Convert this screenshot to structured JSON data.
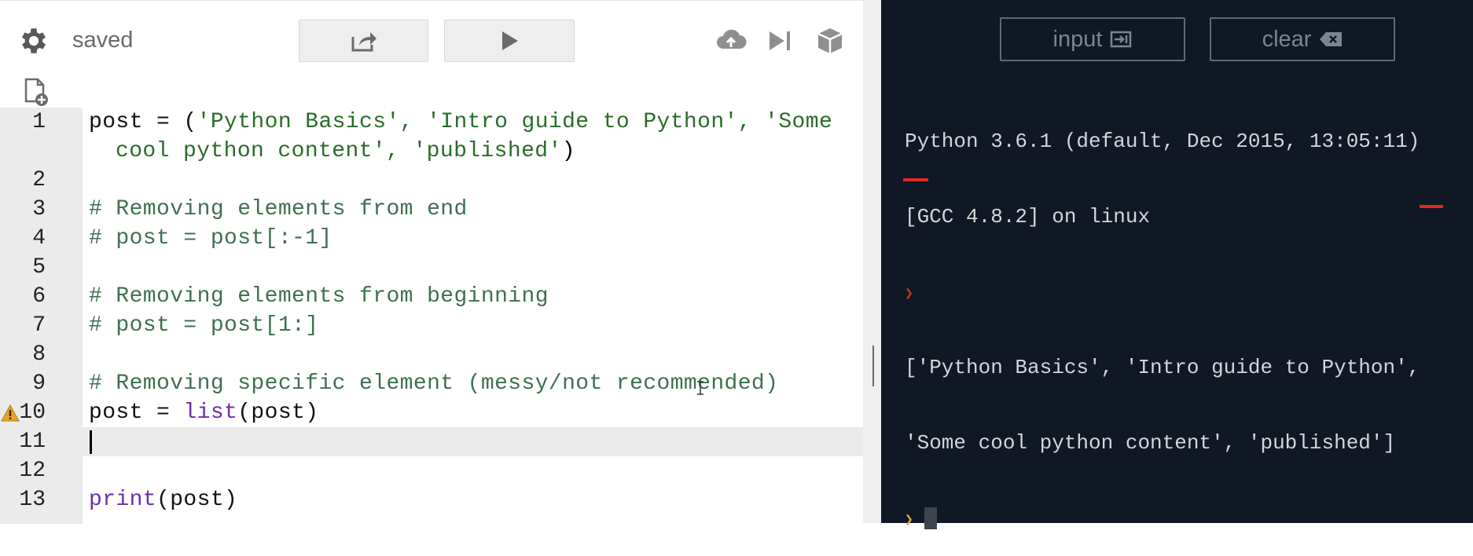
{
  "editor": {
    "status": "saved",
    "toolbar": {
      "icons": [
        "gear-icon",
        "share-icon",
        "play-icon",
        "cloud-upload-icon",
        "step-end-icon",
        "package-icon",
        "new-file-icon"
      ]
    },
    "lines": [
      {
        "n": "1",
        "a": "post = (",
        "b": "'Python Basics', 'Intro guide to Python', 'Some",
        "c": "cool python content', 'published'",
        "d": ")"
      },
      {
        "n": "2"
      },
      {
        "n": "3",
        "comment": "# Removing elements from end"
      },
      {
        "n": "4",
        "comment": "# post = post[:-1]"
      },
      {
        "n": "5"
      },
      {
        "n": "6",
        "comment": "# Removing elements from beginning"
      },
      {
        "n": "7",
        "comment": "# post = post[1:]"
      },
      {
        "n": "8"
      },
      {
        "n": "9",
        "comment": "# Removing specific element (messy/not recommended)"
      },
      {
        "n": "10",
        "pre": "post = ",
        "fn": "list",
        "post": "(post)",
        "warning": true
      },
      {
        "n": "11",
        "active": true
      },
      {
        "n": "12"
      },
      {
        "n": "13",
        "fn": "print",
        "post": "(post)"
      }
    ]
  },
  "console": {
    "input_label": "input",
    "clear_label": "clear",
    "banner1": "Python 3.6.1 (default, Dec 2015, 13:05:11)",
    "banner2": "[GCC 4.8.2] on linux",
    "out1": "['Python Basics', 'Intro guide to Python',",
    "out2": "'Some cool python content', 'published']"
  },
  "colors": {
    "console_bg": "#0f1824",
    "string": "#2b6b2b",
    "comment": "#3f6f50",
    "builtin": "#6e2fa8",
    "highlight": "#e02a1f"
  }
}
